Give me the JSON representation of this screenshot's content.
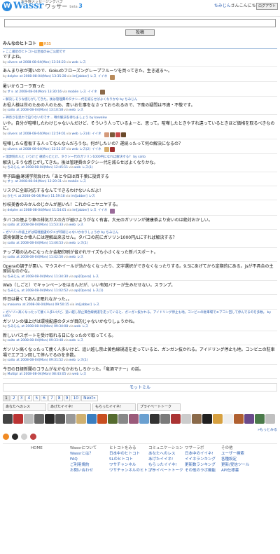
{
  "header": {
    "tagline": "お手軽メッセージングハブ",
    "logo_mark": "W",
    "logo_text": "Wassr",
    "logo_kana": "ワッサー",
    "beta_word": "beta",
    "beta_num": "3",
    "greeting_user": "ちみじん",
    "greeting_suffix": "さんこんにちは!",
    "logout": "ログアウト"
  },
  "compose": {
    "button": "投稿"
  },
  "timeline": {
    "title": "みんなのヒトコト",
    "rss": "RSS",
    "entries": [
      {
        "reply": "» ここ最近のヒトコトは至福のみご公開です",
        "text": "ですよね。",
        "meta_prefix": "by",
        "user": "silvers",
        "date": "at 2008-08-04(Mon) 13:36:23",
        "via": "via",
        "source": "web",
        "res": "レス",
        "favs": []
      },
      {
        "reply": "",
        "text": "あんまり氷が薄いので、Gokuのフローズングレープフルーツを買ってきた。生き返る～。",
        "meta_prefix": "by",
        "user": "delphe",
        "date": "at 2008-08-04(Mon) 13:35:28",
        "via": "via",
        "source": "im[jabber]",
        "res": "レス",
        "like": "イイネ",
        "favs": [
          "#b88a5a"
        ]
      },
      {
        "reply": "",
        "text": "暑いからコーラ買った",
        "meta_prefix": "by",
        "user": "すぅ",
        "date": "at 2008-08-04(Mon) 13:30:16",
        "via": "via",
        "source": "mobile",
        "res": "レス",
        "like": "イイネ",
        "favs": [
          "#8c6a4a"
        ]
      },
      {
        "reply": "» 解決しそうな感じがしてきた。後は管理費のタクシー代を減らせばよくなりかな by ちみじん",
        "text": "お役人様は世のための人のため、青いお仕事をなさっておられるので、下衆の疑問は不適・不敬です。",
        "meta_prefix": "by",
        "user": "saito",
        "date": "at 2008-08-04(Mon) 13:10:58",
        "via": "via",
        "source": "web",
        "res": "レス",
        "favs": []
      },
      {
        "reply": "» 神奈さを思わで迫りないのです... 噂の解決を待ちましょう by kawakw",
        "text": "いや。自分が喧嘩したわけじゃないんだけど、そういう人っているよーと、思って。喧嘩したときやすれ違っているときほど価格を取るべきなのに。",
        "meta_prefix": "by",
        "user": "silvers",
        "date": "at 2008-08-04(Mon) 12:59:01",
        "via": "via",
        "source": "web",
        "res": "レス(4)",
        "like": "イイネ",
        "favs": [
          "#d49a7a",
          "#7a5a3a",
          "#c84a4a",
          "#6a4a2a"
        ]
      },
      {
        "reply": "",
        "text": "喧嘩したら看板する人ってなんなんだろうな。何がしたいの？運続ったって何の解決になるの？",
        "meta_prefix": "by",
        "user": "silvers",
        "date": "at 2008-08-04(Mon) 12:52:37",
        "via": "via",
        "source": "web",
        "res": "レス(2)",
        "like": "イイネ",
        "favs": [
          "#d8b070",
          "#a03030"
        ]
      },
      {
        "reply": "» 瑞衆院の人と いうけど 運続ったとけ、タクシー代のガソリン1000円になれば解決する？ by saito",
        "text": "解決しそうな感じがしてきた。後は管理費のタクシー代を減らせばよくなりかな。",
        "meta_prefix": "by",
        "user": "ちみじん",
        "date": "at 2008-08-04(Mon) 12:45:11",
        "via": "via",
        "source": "web",
        "res": "レス(1)",
        "favs": []
      },
      {
        "reply": "",
        "text": "甲子園🏟寒浦学院負けた「あと今日は西千葉に投資する",
        "meta_prefix": "by",
        "user": "すぅ",
        "date": "at 2008-08-04(Mon) 12:20:31",
        "via": "via",
        "source": "mobile",
        "res": "レス",
        "favs": []
      },
      {
        "reply": "",
        "text": "リスクに全部対応するなんてできるわけないんだよ！",
        "meta_prefix": "by",
        "user": "かとべ",
        "date": "at 2008-08-04(Mon) 11:59:18",
        "via": "via",
        "source": "im[jabber]",
        "res": "レス",
        "favs": []
      },
      {
        "reply": "",
        "text": "杉岐美香のみかんのじかんが届いた！これからニヤニヤする。",
        "meta_prefix": "by",
        "user": "delphe",
        "date": "at 2008-08-04(Mon) 11:54:01",
        "via": "via",
        "source": "im[jabber]",
        "res": "レス",
        "like": "イイネ",
        "favs": [
          "#9a6a9a"
        ]
      },
      {
        "reply": "",
        "text": "タバコの煙より車の排気ガスの方が避けようがなく有害。大元のガソリンが健康茶より安いのは絶対おかしい。",
        "meta_prefix": "by",
        "user": "saito",
        "date": "at 2008-08-04(Mon) 11:53:33",
        "via": "via",
        "source": "web",
        "res": "レス",
        "favs": []
      },
      {
        "reply": "» ガソリンの値上げは環境配慮のタメが印刷じゃないかなりしょうか by ちみじん",
        "text": "環境保護とか偉人には理解出来ません。タバコの前にガソリン1000円/Lにすれば解決する？",
        "meta_prefix": "by",
        "user": "saito",
        "date": "at 2008-08-04(Mon) 11:46:53",
        "via": "via",
        "source": "web",
        "res": "レス(1)",
        "favs": []
      },
      {
        "reply": "",
        "text": "チップ増の込みになったか金額印刷が省かれサイズも小さくなった新パスポート。",
        "meta_prefix": "by",
        "user": "saito",
        "date": "at 2008-08-04(Mon) 11:42:56",
        "via": "via",
        "source": "web",
        "res": "レス",
        "favs": []
      },
      {
        "reply": "",
        "text": "Operaの調子が悪い。マウスホイールが効かなくなったり、文字選択ができなくなったりする。9.5にあげてから定期的にある。jsが不具合の主原因なのかな。",
        "meta_prefix": "by",
        "user": "ちみじん",
        "date": "at 2008-08-04(Mon) 11:34:30",
        "via": "via",
        "source": "api[Opera]",
        "res": "レス",
        "favs": []
      },
      {
        "reply": "",
        "text": "Web（しごと）でキャンペーンをはるんだが、いい有知バナーが生みだせない。スランプ。",
        "meta_prefix": "by",
        "user": "ちみじん",
        "date": "at 2008-08-04(Mon) 11:02:52",
        "via": "via",
        "source": "api[Opera]",
        "res": "レス(1)",
        "favs": []
      },
      {
        "reply": "",
        "text": "昨日は暑くてあんま眠れなかった。。",
        "meta_prefix": "by",
        "user": "makoma",
        "date": "at 2008-08-04(Mon) 09:50:15",
        "via": "via",
        "source": "im[jabber]",
        "res": "レス",
        "favs": []
      },
      {
        "reply": "» ガソリン高くなったって痩く人多いけど、追い越し禁止黄色線規道を走っていると、ガンガン抜かれる。アイドリング停止も地。コンビニの駐車場でエアコン回して停んでるのを多数。 by saito",
        "text": "ガソリンの値上げは環境配慮のタメが目的じゃないかなりしょうかね。",
        "meta_prefix": "by",
        "user": "ちみじん",
        "date": "at 2008-08-04(Mon) 09:34:08",
        "via": "via",
        "source": "web",
        "res": "レス",
        "favs": []
      },
      {
        "reply": "",
        "text": "新しいパスポートを受け取れる日になったので取ってくる。",
        "meta_prefix": "by",
        "user": "saito",
        "date": "at 2008-08-04(Mon) 09:33:48",
        "via": "via",
        "source": "web",
        "res": "レス",
        "favs": []
      },
      {
        "reply": "",
        "text": "ガソリン高くなったって痩く人多いけど、追い越し禁止黄色線規道を走っていると、ガンガン抜かれる。アイドリング停止も地。コンビニの駐車場でエアコン回して停んでるのを多数。",
        "meta_prefix": "by",
        "user": "saito",
        "date": "at 2008-08-04(Mon) 09:31:52",
        "via": "via",
        "source": "web",
        "res": "レス(1)",
        "favs": []
      },
      {
        "reply": "",
        "text": "今日の日経新聞のコラムがなかなかおもしろかった。「竜酒マナー」の話。",
        "meta_prefix": "by",
        "user": "Multipl",
        "date": "at 2008-08-04(Mon) 08:43:05",
        "via": "via",
        "source": "web",
        "res": "レス",
        "favs": []
      }
    ],
    "more": "モットミル"
  },
  "pager": {
    "pages": [
      "1",
      "2",
      "3",
      "4",
      "5",
      "6",
      "7",
      "8",
      "9",
      "10"
    ],
    "next": "Next»",
    "current": "1"
  },
  "tabs": [
    "あなたへのレス",
    "あげたイイネ!",
    "もらったイイネ!",
    "プライベートトーク"
  ],
  "avatars": [
    "#444",
    "#bb3333",
    "#bdbdbd",
    "#6a6a6a",
    "#2a2a2a",
    "#555",
    "#999",
    "#cfb070",
    "#3a7ec0",
    "#c84e20",
    "#556b2f",
    "#888",
    "#9a5a7a",
    "#6aa0d0",
    "#333",
    "#7a7a7a",
    "#aa3333",
    "#ccc",
    "#8a6a4a",
    "#202020",
    "#d6a040",
    "#eee",
    "#b06030",
    "#6a4a8a",
    "#4a7a4a",
    "#c0c0c0"
  ],
  "footer": {
    "to_top": "»もっとみる",
    "icons": [
      "#f08a24",
      "#2a2a2a",
      "#d0d0d0",
      "#c04040"
    ],
    "cols": [
      {
        "head": "HOME",
        "items": []
      },
      {
        "head": "Wassrについて",
        "items": [
          "Wassrとは？",
          "FAQ",
          "ご利用規約",
          "お問い合わせ"
        ]
      },
      {
        "head": "ヒトコトをみる",
        "items": [
          "日本中のヒトコト",
          "SLのヒトコト",
          "ワサチャンネル",
          "ワサチャンネルのヒトコト"
        ]
      },
      {
        "head": "コミュニケーション",
        "items": [
          "あなたへのレス",
          "あげたイイネ!",
          "もらったイイネ!",
          "プライベートトーク"
        ]
      },
      {
        "head": "ワサーラボ",
        "items": [
          "日本中のイイネ!",
          "イイネランキング",
          "更新数ランキング",
          "その他のラボ機能"
        ]
      },
      {
        "head": "その他",
        "items": [
          "ユーザー検索",
          "各種設定",
          "更新/受信ツール",
          "API仕様書"
        ]
      }
    ]
  }
}
